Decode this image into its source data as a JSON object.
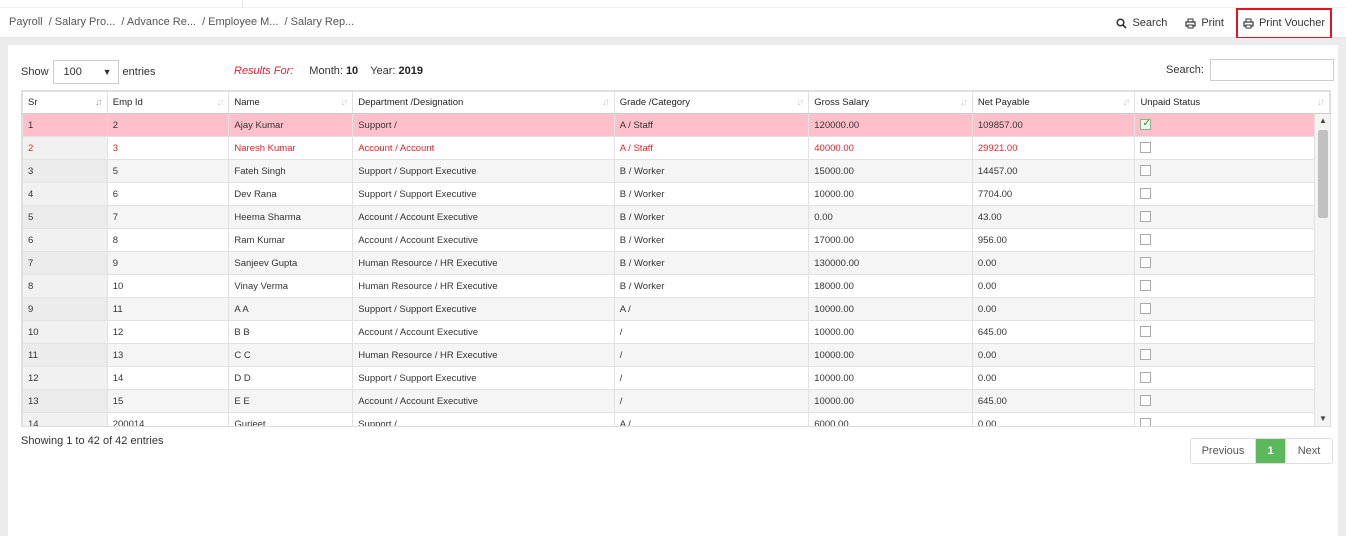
{
  "breadcrumb": [
    "Payroll",
    "/ Salary Pro...",
    "/ Advance Re...",
    "/ Employee M...",
    "/ Salary Rep..."
  ],
  "toolbar": {
    "search_label": "Search",
    "print_label": "Print",
    "print_voucher_label": "Print Voucher",
    "highlight_color": "#e0141e"
  },
  "controls": {
    "show_label": "Show",
    "page_size": "100",
    "entries_label": "entries",
    "results_for": "Results For:",
    "month_label": "Month:",
    "month_value": "10",
    "year_label": "Year:",
    "year_value": "2019",
    "search_label": "Search:",
    "search_value": ""
  },
  "table": {
    "columns": [
      "Sr",
      "Emp Id",
      "Name",
      "Department /Designation",
      "Grade /Category",
      "Gross Salary",
      "Net Payable",
      "Unpaid Status"
    ],
    "rows": [
      {
        "sr": "1",
        "emp_id": "2",
        "name": "Ajay Kumar",
        "dept": "Support /",
        "grade": "A / Staff",
        "gross": "120000.00",
        "net": "109857.00",
        "unpaid": true
      },
      {
        "sr": "2",
        "emp_id": "3",
        "name": "Naresh Kumar",
        "dept": "Account / Account",
        "grade": "A / Staff",
        "gross": "40000.00",
        "net": "29921.00",
        "unpaid": false
      },
      {
        "sr": "3",
        "emp_id": "5",
        "name": "Fateh Singh",
        "dept": "Support / Support Executive",
        "grade": "B / Worker",
        "gross": "15000.00",
        "net": "14457.00",
        "unpaid": false
      },
      {
        "sr": "4",
        "emp_id": "6",
        "name": "Dev Rana",
        "dept": "Support / Support Executive",
        "grade": "B / Worker",
        "gross": "10000.00",
        "net": "7704.00",
        "unpaid": false
      },
      {
        "sr": "5",
        "emp_id": "7",
        "name": "Heema Sharma",
        "dept": "Account / Account Executive",
        "grade": "B / Worker",
        "gross": "0.00",
        "net": "43.00",
        "unpaid": false
      },
      {
        "sr": "6",
        "emp_id": "8",
        "name": "Ram Kumar",
        "dept": "Account / Account Executive",
        "grade": "B / Worker",
        "gross": "17000.00",
        "net": "956.00",
        "unpaid": false
      },
      {
        "sr": "7",
        "emp_id": "9",
        "name": "Sanjeev Gupta",
        "dept": "Human Resource / HR Executive",
        "grade": "B / Worker",
        "gross": "130000.00",
        "net": "0.00",
        "unpaid": false
      },
      {
        "sr": "8",
        "emp_id": "10",
        "name": "Vinay Verma",
        "dept": "Human Resource / HR Executive",
        "grade": "B / Worker",
        "gross": "18000.00",
        "net": "0.00",
        "unpaid": false
      },
      {
        "sr": "9",
        "emp_id": "11",
        "name": "A A",
        "dept": "Support / Support Executive",
        "grade": "A /",
        "gross": "10000.00",
        "net": "0.00",
        "unpaid": false
      },
      {
        "sr": "10",
        "emp_id": "12",
        "name": "B B",
        "dept": "Account / Account Executive",
        "grade": "/",
        "gross": "10000.00",
        "net": "645.00",
        "unpaid": false
      },
      {
        "sr": "11",
        "emp_id": "13",
        "name": "C C",
        "dept": "Human Resource / HR Executive",
        "grade": "/",
        "gross": "10000.00",
        "net": "0.00",
        "unpaid": false
      },
      {
        "sr": "12",
        "emp_id": "14",
        "name": "D D",
        "dept": "Support / Support Executive",
        "grade": "/",
        "gross": "10000.00",
        "net": "0.00",
        "unpaid": false
      },
      {
        "sr": "13",
        "emp_id": "15",
        "name": "E E",
        "dept": "Account / Account Executive",
        "grade": "/",
        "gross": "10000.00",
        "net": "645.00",
        "unpaid": false
      },
      {
        "sr": "14",
        "emp_id": "200014",
        "name": "Gurjeet",
        "dept": "Support /",
        "grade": "A /",
        "gross": "6000.00",
        "net": "0.00",
        "unpaid": false
      }
    ]
  },
  "footer": {
    "info": "Showing 1 to 42 of 42 entries",
    "previous_label": "Previous",
    "current_page": "1",
    "next_label": "Next"
  }
}
